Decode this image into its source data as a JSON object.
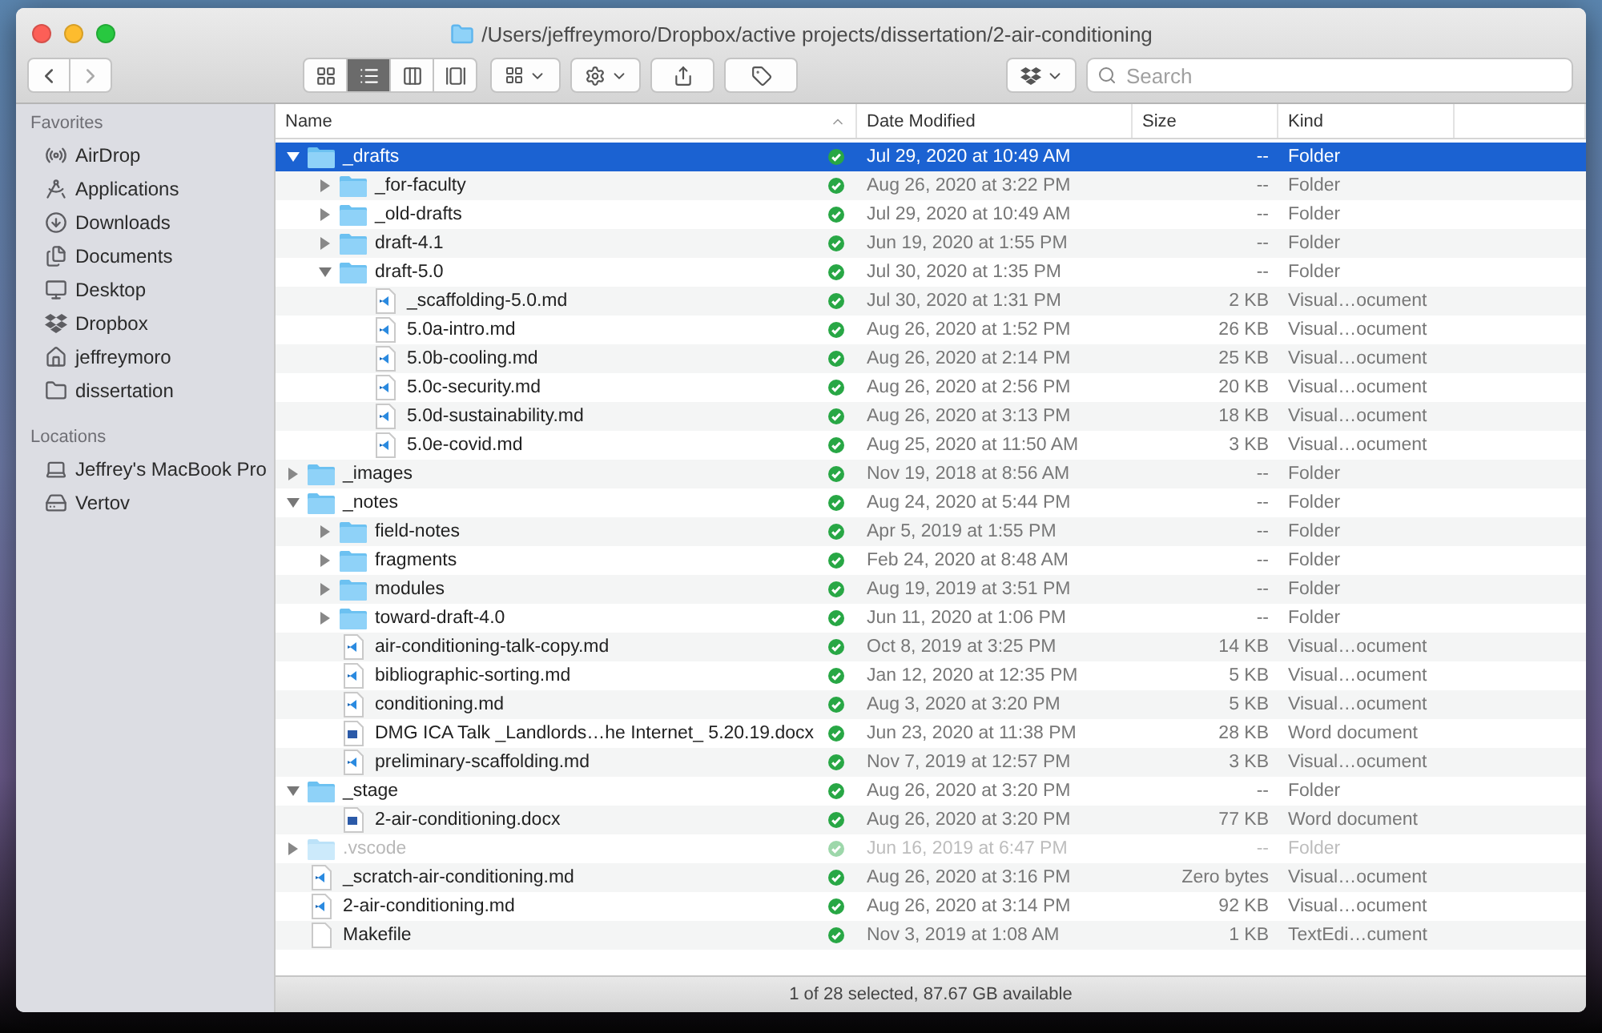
{
  "window": {
    "title": "/Users/jeffreymoro/Dropbox/active projects/dissertation/2-air-conditioning"
  },
  "toolbar": {
    "view_modes": [
      {
        "kind": "icons",
        "selected": false
      },
      {
        "kind": "list",
        "selected": true
      },
      {
        "kind": "columns",
        "selected": false
      },
      {
        "kind": "gallery",
        "selected": false
      }
    ],
    "search": {
      "placeholder": "Search"
    }
  },
  "sidebar": [
    {
      "heading": "Favorites",
      "items": [
        {
          "label": "AirDrop"
        },
        {
          "label": "Applications"
        },
        {
          "label": "Downloads"
        },
        {
          "label": "Documents"
        },
        {
          "label": "Desktop"
        },
        {
          "label": "Dropbox"
        },
        {
          "label": "jeffreymoro"
        },
        {
          "label": "dissertation"
        }
      ]
    },
    {
      "heading": "Locations",
      "items": [
        {
          "label": "Jeffrey's MacBook Pro"
        },
        {
          "label": "Vertov"
        }
      ]
    }
  ],
  "table": {
    "columns": [
      {
        "label": "Name",
        "sorted": true
      },
      {
        "label": "Date Modified",
        "sorted": false
      },
      {
        "label": "Size",
        "sorted": false
      },
      {
        "label": "Kind",
        "sorted": false
      }
    ],
    "rows": [
      {
        "name": "_drafts",
        "kind": "folder",
        "expanded": true,
        "selected": true,
        "dimmed": false,
        "date": "Jul 29, 2020 at 10:49 AM",
        "size": "--",
        "type": "Folder",
        "children": [
          {
            "name": "_for-faculty",
            "kind": "folder",
            "expanded": false,
            "selected": false,
            "dimmed": false,
            "date": "Aug 26, 2020 at 3:22 PM",
            "size": "--",
            "type": "Folder"
          },
          {
            "name": "_old-drafts",
            "kind": "folder",
            "expanded": false,
            "selected": false,
            "dimmed": false,
            "date": "Jul 29, 2020 at 10:49 AM",
            "size": "--",
            "type": "Folder"
          },
          {
            "name": "draft-4.1",
            "kind": "folder",
            "expanded": false,
            "selected": false,
            "dimmed": false,
            "date": "Jun 19, 2020 at 1:55 PM",
            "size": "--",
            "type": "Folder"
          },
          {
            "name": "draft-5.0",
            "kind": "folder",
            "expanded": true,
            "selected": false,
            "dimmed": false,
            "date": "Jul 30, 2020 at 1:35 PM",
            "size": "--",
            "type": "Folder",
            "children": [
              {
                "name": "_scaffolding-5.0.md",
                "kind": "code",
                "selected": false,
                "dimmed": false,
                "date": "Jul 30, 2020 at 1:31 PM",
                "size": "2 KB",
                "type": "Visual…ocument"
              },
              {
                "name": "5.0a-intro.md",
                "kind": "code",
                "selected": false,
                "dimmed": false,
                "date": "Aug 26, 2020 at 1:52 PM",
                "size": "26 KB",
                "type": "Visual…ocument"
              },
              {
                "name": "5.0b-cooling.md",
                "kind": "code",
                "selected": false,
                "dimmed": false,
                "date": "Aug 26, 2020 at 2:14 PM",
                "size": "25 KB",
                "type": "Visual…ocument"
              },
              {
                "name": "5.0c-security.md",
                "kind": "code",
                "selected": false,
                "dimmed": false,
                "date": "Aug 26, 2020 at 2:56 PM",
                "size": "20 KB",
                "type": "Visual…ocument"
              },
              {
                "name": "5.0d-sustainability.md",
                "kind": "code",
                "selected": false,
                "dimmed": false,
                "date": "Aug 26, 2020 at 3:13 PM",
                "size": "18 KB",
                "type": "Visual…ocument"
              },
              {
                "name": "5.0e-covid.md",
                "kind": "code",
                "selected": false,
                "dimmed": false,
                "date": "Aug 25, 2020 at 11:50 AM",
                "size": "3 KB",
                "type": "Visual…ocument"
              }
            ]
          }
        ]
      },
      {
        "name": "_images",
        "kind": "folder",
        "expanded": false,
        "selected": false,
        "dimmed": false,
        "date": "Nov 19, 2018 at 8:56 AM",
        "size": "--",
        "type": "Folder"
      },
      {
        "name": "_notes",
        "kind": "folder",
        "expanded": true,
        "selected": false,
        "dimmed": false,
        "date": "Aug 24, 2020 at 5:44 PM",
        "size": "--",
        "type": "Folder",
        "children": [
          {
            "name": "field-notes",
            "kind": "folder",
            "expanded": false,
            "selected": false,
            "dimmed": false,
            "date": "Apr 5, 2019 at 1:55 PM",
            "size": "--",
            "type": "Folder"
          },
          {
            "name": "fragments",
            "kind": "folder",
            "expanded": false,
            "selected": false,
            "dimmed": false,
            "date": "Feb 24, 2020 at 8:48 AM",
            "size": "--",
            "type": "Folder"
          },
          {
            "name": "modules",
            "kind": "folder",
            "expanded": false,
            "selected": false,
            "dimmed": false,
            "date": "Aug 19, 2019 at 3:51 PM",
            "size": "--",
            "type": "Folder"
          },
          {
            "name": "toward-draft-4.0",
            "kind": "folder",
            "expanded": false,
            "selected": false,
            "dimmed": false,
            "date": "Jun 11, 2020 at 1:06 PM",
            "size": "--",
            "type": "Folder"
          },
          {
            "name": "air-conditioning-talk-copy.md",
            "kind": "code",
            "selected": false,
            "dimmed": false,
            "date": "Oct 8, 2019 at 3:25 PM",
            "size": "14 KB",
            "type": "Visual…ocument"
          },
          {
            "name": "bibliographic-sorting.md",
            "kind": "code",
            "selected": false,
            "dimmed": false,
            "date": "Jan 12, 2020 at 12:35 PM",
            "size": "5 KB",
            "type": "Visual…ocument"
          },
          {
            "name": "conditioning.md",
            "kind": "code",
            "selected": false,
            "dimmed": false,
            "date": "Aug 3, 2020 at 3:20 PM",
            "size": "5 KB",
            "type": "Visual…ocument"
          },
          {
            "name": "DMG ICA Talk _Landlords…he Internet_ 5.20.19.docx",
            "kind": "word",
            "selected": false,
            "dimmed": false,
            "date": "Jun 23, 2020 at 11:38 PM",
            "size": "28 KB",
            "type": "Word document"
          },
          {
            "name": "preliminary-scaffolding.md",
            "kind": "code",
            "selected": false,
            "dimmed": false,
            "date": "Nov 7, 2019 at 12:57 PM",
            "size": "3 KB",
            "type": "Visual…ocument"
          }
        ]
      },
      {
        "name": "_stage",
        "kind": "folder",
        "expanded": true,
        "selected": false,
        "dimmed": false,
        "date": "Aug 26, 2020 at 3:20 PM",
        "size": "--",
        "type": "Folder",
        "children": [
          {
            "name": "2-air-conditioning.docx",
            "kind": "word",
            "selected": false,
            "dimmed": false,
            "date": "Aug 26, 2020 at 3:20 PM",
            "size": "77 KB",
            "type": "Word document"
          }
        ]
      },
      {
        "name": ".vscode",
        "kind": "folder",
        "expanded": false,
        "selected": false,
        "dimmed": true,
        "date": "Jun 16, 2019 at 6:47 PM",
        "size": "--",
        "type": "Folder"
      },
      {
        "name": "_scratch-air-conditioning.md",
        "kind": "code",
        "selected": false,
        "dimmed": false,
        "date": "Aug 26, 2020 at 3:16 PM",
        "size": "Zero bytes",
        "type": "Visual…ocument"
      },
      {
        "name": "2-air-conditioning.md",
        "kind": "code",
        "selected": false,
        "dimmed": false,
        "date": "Aug 26, 2020 at 3:14 PM",
        "size": "92 KB",
        "type": "Visual…ocument"
      },
      {
        "name": "Makefile",
        "kind": "text",
        "selected": false,
        "dimmed": false,
        "date": "Nov 3, 2019 at 1:08 AM",
        "size": "1 KB",
        "type": "TextEdi…cument"
      }
    ]
  },
  "status_bar": "1 of 28 selected, 87.67 GB available"
}
